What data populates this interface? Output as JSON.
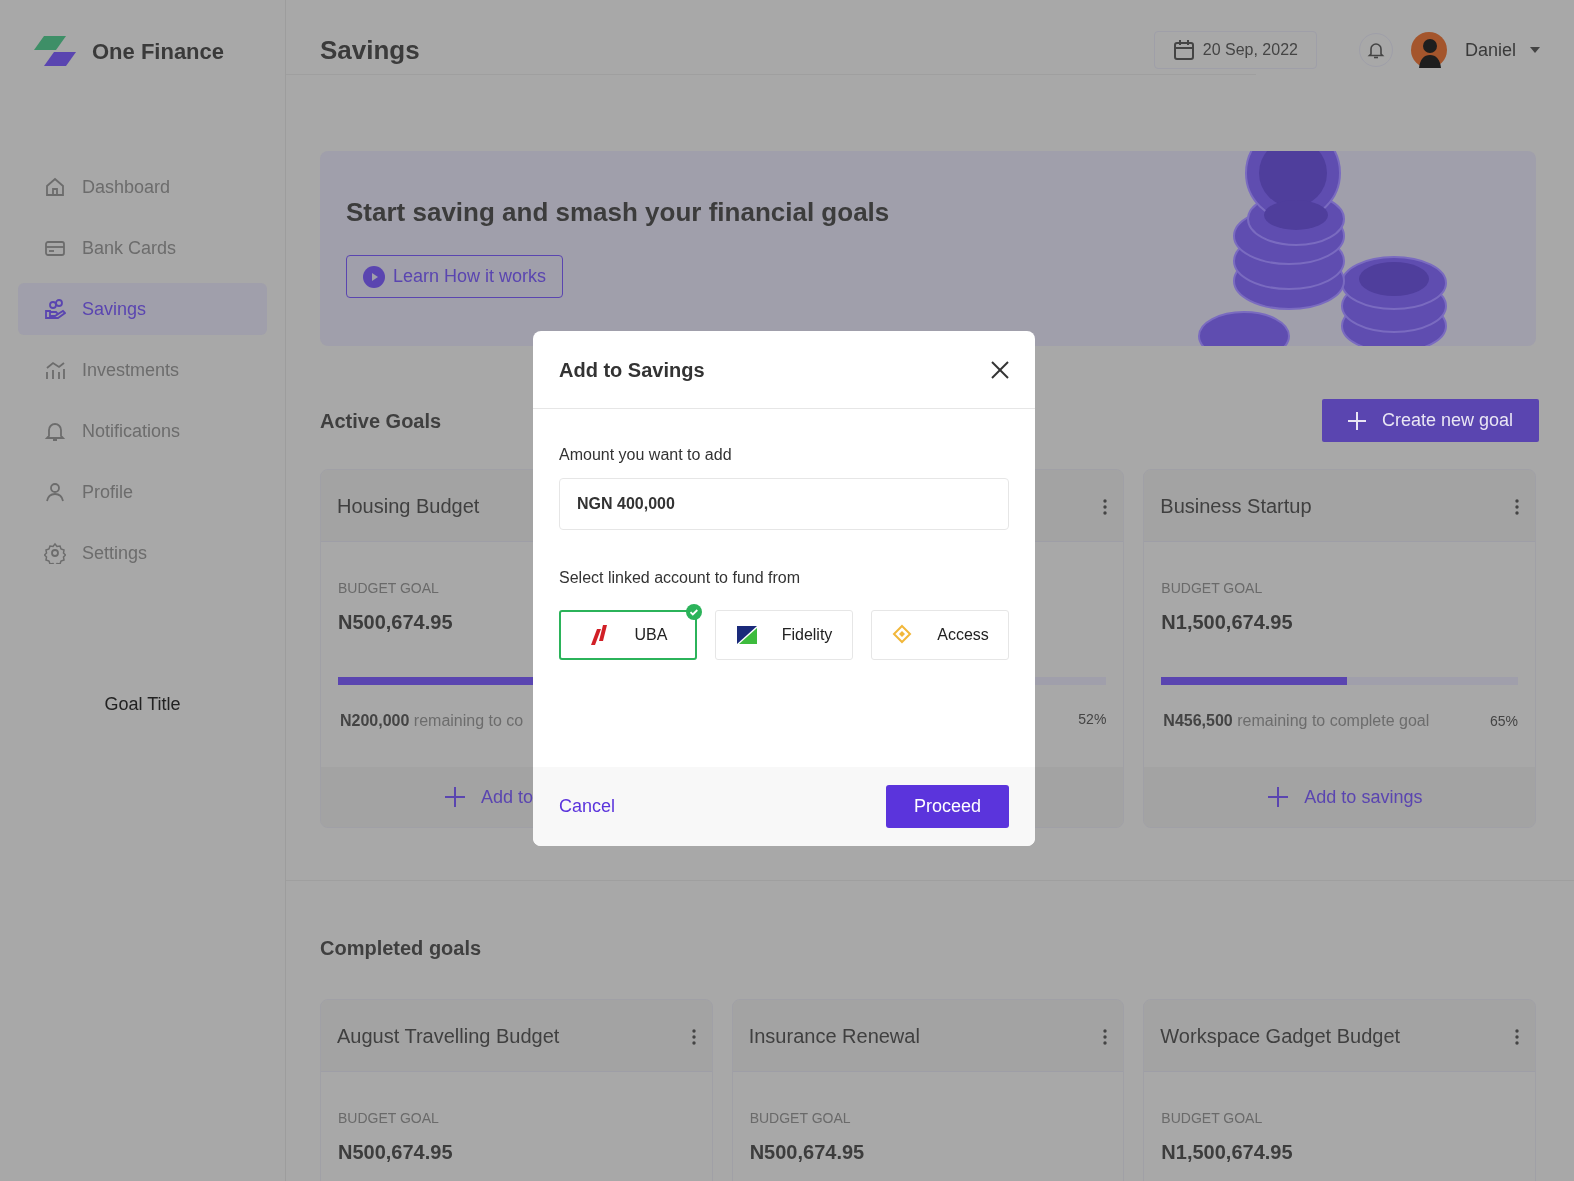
{
  "sidebar": {
    "brand": "One Finance",
    "items": [
      {
        "label": "Dashboard",
        "selected": false
      },
      {
        "label": "Bank Cards",
        "selected": false
      },
      {
        "label": "Savings",
        "selected": true
      },
      {
        "label": "Investments",
        "selected": false
      },
      {
        "label": "Notifications",
        "selected": false
      },
      {
        "label": "Profile",
        "selected": false
      },
      {
        "label": "Settings",
        "selected": false
      }
    ],
    "footer_text": "Goal Title"
  },
  "header": {
    "title": "Savings",
    "date": "20 Sep, 2022",
    "user": "Daniel"
  },
  "banner": {
    "heading": "Start saving and smash your financial goals",
    "button": "Learn How it works"
  },
  "active_goals": {
    "title": "Active Goals",
    "create_button": "Create new goal",
    "goals": [
      {
        "title": "Housing Budget",
        "label": "BUDGET GOAL",
        "amount": "N500,674.95",
        "remaining_amount": "N200,000",
        "remaining_text": "remaining to co",
        "level": 0.6,
        "action": "Add to"
      },
      {
        "percent": "52%"
      },
      {
        "title": "Business Startup",
        "label": "BUDGET GOAL",
        "amount": "N1,500,674.95",
        "remaining_amount": "N456,500",
        "remaining_text": "remaining to complete goal",
        "percent": "65%",
        "level": 0.52,
        "action": "Add to savings"
      }
    ]
  },
  "completed_goals": {
    "title": "Completed goals",
    "goals": [
      {
        "title": "August Travelling Budget",
        "label": "BUDGET GOAL",
        "amount": "N500,674.95"
      },
      {
        "title": "Insurance Renewal",
        "label": "BUDGET GOAL",
        "amount": "N500,674.95"
      },
      {
        "title": "Workspace Gadget Budget",
        "label": "BUDGET GOAL",
        "amount": "N1,500,674.95"
      }
    ]
  },
  "modal": {
    "title": "Add to Savings",
    "amount_label": "Amount you want to add",
    "amount_value": "NGN 400,000",
    "account_label": "Select linked account to fund from",
    "accounts": [
      {
        "name": "UBA",
        "selected": true
      },
      {
        "name": "Fidelity",
        "selected": false
      },
      {
        "name": "Access",
        "selected": false
      }
    ],
    "cancel": "Cancel",
    "proceed": "Proceed"
  }
}
